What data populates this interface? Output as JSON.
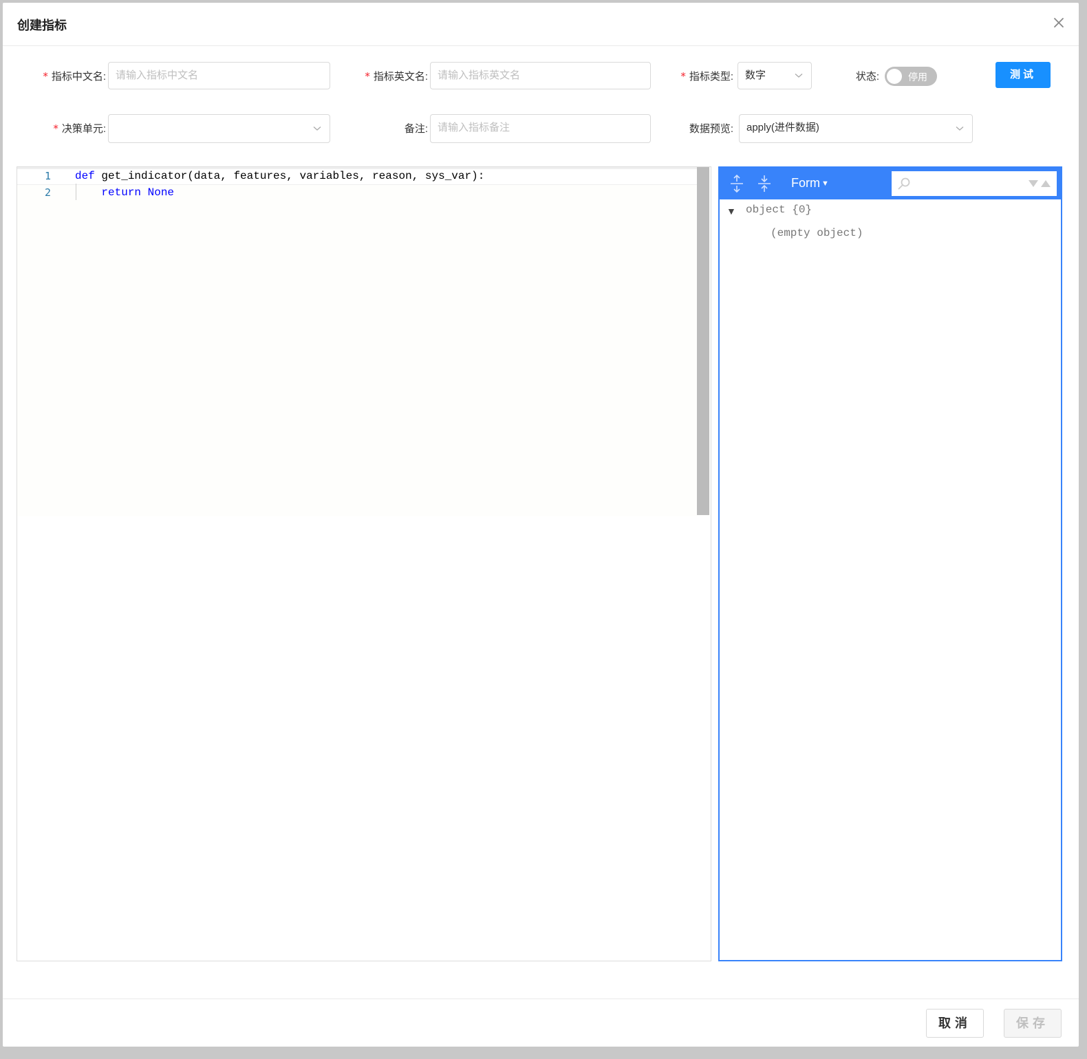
{
  "modal": {
    "title": "创建指标"
  },
  "form": {
    "name_cn": {
      "label": "指标中文名:",
      "placeholder": "请输入指标中文名",
      "required": true
    },
    "name_en": {
      "label": "指标英文名:",
      "placeholder": "请输入指标英文名",
      "required": true
    },
    "type": {
      "label": "指标类型:",
      "value": "数字",
      "required": true
    },
    "status": {
      "label": "状态:",
      "toggle_text": "停用",
      "enabled": false
    },
    "test_button": "测试",
    "decision_unit": {
      "label": "决策单元:",
      "value": "",
      "required": true
    },
    "remark": {
      "label": "备注:",
      "placeholder": "请输入指标备注"
    },
    "data_preview": {
      "label": "数据预览:",
      "value": "apply(进件数据)"
    }
  },
  "code_editor": {
    "line_numbers": [
      "1",
      "2"
    ],
    "lines": [
      {
        "kw": "def",
        "rest": " get_indicator(data, features, variables, reason, sys_var):"
      },
      {
        "indent": "    ",
        "kw": "return None",
        "rest": ""
      }
    ]
  },
  "json_viewer": {
    "mode_label": "Form",
    "tree": {
      "root_label": "object {0}",
      "empty_text": "(empty object)"
    }
  },
  "footer": {
    "cancel": "取消",
    "save": "保存"
  },
  "colors": {
    "primary": "#1890ff",
    "json_accent": "#3883fa",
    "required": "#f5222d",
    "keyword": "#0000ff"
  }
}
